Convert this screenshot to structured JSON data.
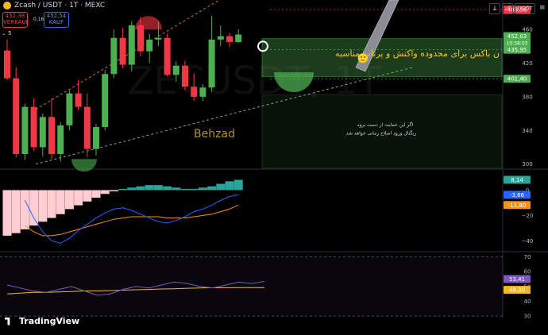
{
  "header": {
    "symbol": "Zcash / USDT · 1T · MEXC",
    "sell_price": "452,38",
    "sell_label": "VERKAUF",
    "spread": "0,16",
    "buy_price": "452,54",
    "buy_label": "KAUF",
    "collapsed_count": "5",
    "currency": "USDT"
  },
  "colors": {
    "up": "#4caf50",
    "down": "#f23645",
    "ma_fast": "#2962ff",
    "ma_slow": "#f7931a",
    "rsi": "#7e57c2",
    "rsi_ma": "#f4b728"
  },
  "watermark": "ZECUSDT, 1T",
  "annotations": {
    "author": "Behzad",
    "box_text": "ن باکس برای محدوده واکنش و پرتاب مناسبه",
    "box_emoji": "🙂",
    "note_line1": "اگر این حمایت از دست برود",
    "note_line2": "زیگنال ورود اصلاح زمانی خواهد شد"
  },
  "branding": "TradingView",
  "chart_data": [
    {
      "type": "candlestick",
      "title": "Zcash / USDT · 1T · MEXC",
      "ylim": [
        295,
        495
      ],
      "y_ticks": [
        460,
        420,
        380,
        340,
        300
      ],
      "candles": [
        {
          "o": 435,
          "h": 448,
          "l": 400,
          "c": 402
        },
        {
          "o": 402,
          "h": 415,
          "l": 308,
          "c": 312
        },
        {
          "o": 312,
          "h": 372,
          "l": 305,
          "c": 368
        },
        {
          "o": 368,
          "h": 378,
          "l": 316,
          "c": 320
        },
        {
          "o": 320,
          "h": 360,
          "l": 309,
          "c": 356
        },
        {
          "o": 356,
          "h": 378,
          "l": 306,
          "c": 312
        },
        {
          "o": 312,
          "h": 350,
          "l": 303,
          "c": 346
        },
        {
          "o": 346,
          "h": 388,
          "l": 340,
          "c": 384
        },
        {
          "o": 384,
          "h": 400,
          "l": 364,
          "c": 368
        },
        {
          "o": 368,
          "h": 384,
          "l": 308,
          "c": 318
        },
        {
          "o": 318,
          "h": 348,
          "l": 310,
          "c": 344
        },
        {
          "o": 344,
          "h": 412,
          "l": 340,
          "c": 407
        },
        {
          "o": 407,
          "h": 460,
          "l": 402,
          "c": 450
        },
        {
          "o": 450,
          "h": 462,
          "l": 414,
          "c": 418
        },
        {
          "o": 418,
          "h": 470,
          "l": 410,
          "c": 465
        },
        {
          "o": 465,
          "h": 475,
          "l": 428,
          "c": 434
        },
        {
          "o": 434,
          "h": 455,
          "l": 420,
          "c": 448
        },
        {
          "o": 448,
          "h": 470,
          "l": 440,
          "c": 450
        },
        {
          "o": 450,
          "h": 455,
          "l": 404,
          "c": 406
        },
        {
          "o": 406,
          "h": 422,
          "l": 398,
          "c": 417
        },
        {
          "o": 417,
          "h": 423,
          "l": 388,
          "c": 392
        },
        {
          "o": 392,
          "h": 408,
          "l": 375,
          "c": 380
        },
        {
          "o": 380,
          "h": 395,
          "l": 375,
          "c": 391
        },
        {
          "o": 391,
          "h": 476,
          "l": 386,
          "c": 448
        },
        {
          "o": 448,
          "h": 465,
          "l": 440,
          "c": 452
        },
        {
          "o": 452,
          "h": 456,
          "l": 439,
          "c": 445
        },
        {
          "o": 445,
          "h": 460,
          "l": 444,
          "c": 454
        }
      ],
      "price_labels": [
        {
          "value": 483.56,
          "text": "483,56",
          "color": "#f23645"
        },
        {
          "value": 452.03,
          "text": "452,03",
          "sub": "10:38:03",
          "color": "#4caf50"
        },
        {
          "value": 435.95,
          "text": "435,95",
          "color": "#4caf50"
        },
        {
          "value": 401.4,
          "text": "401,40",
          "color": "#4caf50"
        }
      ]
    },
    {
      "type": "histogram",
      "ylim": [
        -48,
        16
      ],
      "y_ticks": [
        0,
        -20,
        -40
      ],
      "values": [
        -36,
        -34,
        -31,
        -28,
        -25,
        -22,
        -19,
        -15,
        -12,
        -9,
        -6,
        -3,
        -1,
        1,
        2,
        3,
        4,
        4,
        3,
        2,
        1,
        1,
        2,
        3,
        5,
        7,
        8.14
      ],
      "series": [
        {
          "values": [
            -8,
            -22,
            -33,
            -40,
            -42,
            -38,
            -32,
            -27,
            -22,
            -18,
            -15,
            -14,
            -16,
            -19,
            -22,
            -25,
            -26,
            -24,
            -21,
            -17,
            -15,
            -12,
            -8,
            -5,
            -3.66
          ]
        },
        {
          "values": [
            -28,
            -33,
            -36,
            -36,
            -35,
            -33,
            -31,
            -29,
            -27,
            -25,
            -23,
            -22,
            -21,
            -21,
            -21,
            -21,
            -22,
            -22,
            -22,
            -21,
            -20,
            -19,
            -17,
            -15,
            -11.8
          ]
        }
      ],
      "labels": [
        {
          "text": "8,14",
          "value": 8.14,
          "color": "#26a69a"
        },
        {
          "text": "-3,66",
          "value": -3.66,
          "color": "#2962ff"
        },
        {
          "text": "-11,80",
          "value": -11.8,
          "color": "#f7931a"
        }
      ]
    },
    {
      "type": "line",
      "ylim": [
        29,
        73
      ],
      "y_ticks": [
        70,
        60,
        50,
        40,
        30
      ],
      "series": [
        {
          "values": [
            51,
            49,
            47,
            46,
            48,
            50,
            47,
            44,
            45,
            48,
            50,
            49,
            51,
            53,
            52,
            50,
            49,
            51,
            53,
            52,
            53.41
          ]
        },
        {
          "values": [
            45,
            45.5,
            46,
            46,
            46.3,
            46.6,
            47,
            47,
            47.2,
            47.5,
            47.8,
            48,
            48.3,
            48.5,
            48.8,
            49,
            49.1,
            49.2,
            49.3,
            49.3,
            49.3
          ]
        }
      ],
      "labels": [
        {
          "text": "53,41",
          "value": 53.41,
          "color": "#7e57c2"
        },
        {
          "text": "49,30",
          "value": 49.3,
          "color": "#f4b728"
        }
      ]
    }
  ]
}
